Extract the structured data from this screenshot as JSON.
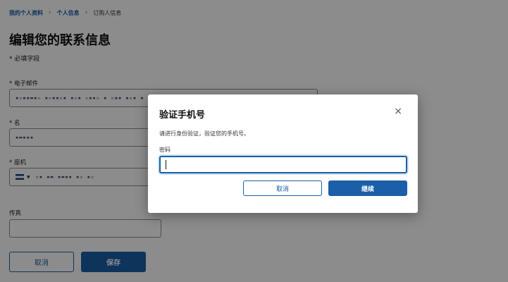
{
  "breadcrumb": {
    "items": [
      "我的个人资料",
      "个人信息",
      "订购人信息"
    ],
    "separator": "›"
  },
  "page": {
    "title": "编辑您的联系信息",
    "required_note": "* 必填字段"
  },
  "form": {
    "email": {
      "label": "* 电子邮件",
      "masked_value": "▪▫▪▪▬▪▫ ▪▫▪▪▫▪ ▪▫▪ ▫▪▪▫ ▪ ▫▪▪ ▪▫▪ ▪"
    },
    "name": {
      "label": "* 名",
      "masked_value": "▪▬▪▪▪"
    },
    "phone": {
      "label": "* 座机",
      "masked_value": "▫▪ ▪▬ ▪▬▪▪ ▪▫ ▪▫"
    },
    "fax": {
      "label": "传真",
      "value": ""
    },
    "cancel_label": "取消",
    "save_label": "保存"
  },
  "modal": {
    "title": "验证手机号",
    "close_icon": "×",
    "description": "请进行身份验证，验证您的手机号。",
    "password_label": "密码",
    "password_value": "",
    "cancel_label": "取消",
    "continue_label": "继续"
  },
  "colors": {
    "primary": "#1a5fa8",
    "overlay": "rgba(0,0,0,0.45)"
  }
}
